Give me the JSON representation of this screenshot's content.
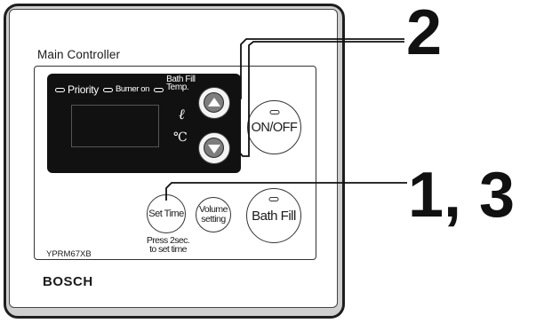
{
  "controller": {
    "title": "Main Controller",
    "indicators": {
      "priority": "Priority",
      "burner_on": "Burner on",
      "bath_fill_temp_line1": "Bath Fill",
      "bath_fill_temp_line2": "Temp."
    },
    "units": {
      "liter": "ℓ",
      "celsius": "℃"
    },
    "buttons": {
      "on_off": "ON/OFF",
      "set_time": "Set Time",
      "volume_line1": "Volume",
      "volume_line2": "setting",
      "bath_fill": "Bath Fill"
    },
    "hint": {
      "line1": "Press 2sec.",
      "line2": "to set time"
    },
    "model": "YPRM67XB",
    "brand": "BOSCH"
  },
  "callouts": {
    "arrows": "2",
    "set_time_and_bath_fill": "1, 3"
  },
  "icons": {
    "up": "triangle-up-icon",
    "down": "triangle-down-icon",
    "led": "indicator-led-icon"
  },
  "colors": {
    "display": "#111111",
    "arrow_button": "#7d7d7d",
    "shell": "#cfcfcf"
  }
}
